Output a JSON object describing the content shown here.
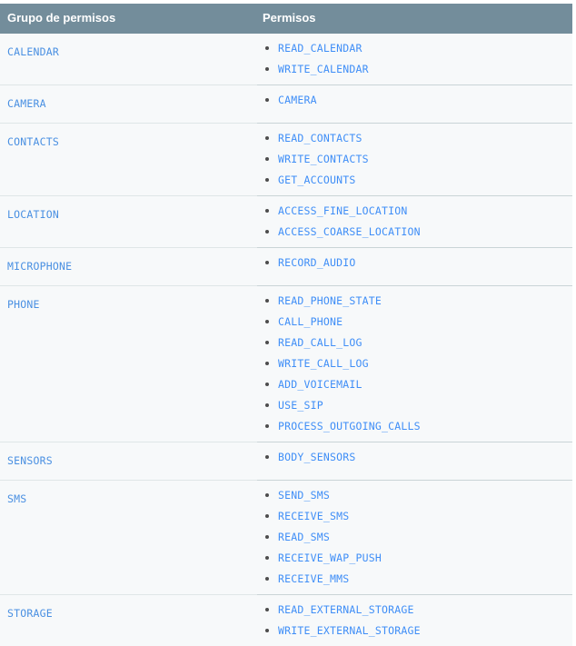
{
  "table": {
    "headers": {
      "group": "Grupo de permisos",
      "permissions": "Permisos"
    },
    "header_bg": "#738d9b",
    "header_text_color": "#ffffff",
    "row_bg": "#f7f9fa",
    "link_color": "#3f8ef7",
    "bullet_color": "#4d4d4d",
    "border_color": "#c9d4d6",
    "rows": [
      {
        "group": "CALENDAR",
        "permissions": [
          "READ_CALENDAR",
          "WRITE_CALENDAR"
        ]
      },
      {
        "group": "CAMERA",
        "permissions": [
          "CAMERA"
        ]
      },
      {
        "group": "CONTACTS",
        "permissions": [
          "READ_CONTACTS",
          "WRITE_CONTACTS",
          "GET_ACCOUNTS"
        ]
      },
      {
        "group": "LOCATION",
        "permissions": [
          "ACCESS_FINE_LOCATION",
          "ACCESS_COARSE_LOCATION"
        ]
      },
      {
        "group": "MICROPHONE",
        "permissions": [
          "RECORD_AUDIO"
        ]
      },
      {
        "group": "PHONE",
        "permissions": [
          "READ_PHONE_STATE",
          "CALL_PHONE",
          "READ_CALL_LOG",
          "WRITE_CALL_LOG",
          "ADD_VOICEMAIL",
          "USE_SIP",
          "PROCESS_OUTGOING_CALLS"
        ]
      },
      {
        "group": "SENSORS",
        "permissions": [
          "BODY_SENSORS"
        ]
      },
      {
        "group": "SMS",
        "permissions": [
          "SEND_SMS",
          "RECEIVE_SMS",
          "READ_SMS",
          "RECEIVE_WAP_PUSH",
          "RECEIVE_MMS"
        ]
      },
      {
        "group": "STORAGE",
        "permissions": [
          "READ_EXTERNAL_STORAGE",
          "WRITE_EXTERNAL_STORAGE"
        ]
      }
    ]
  }
}
